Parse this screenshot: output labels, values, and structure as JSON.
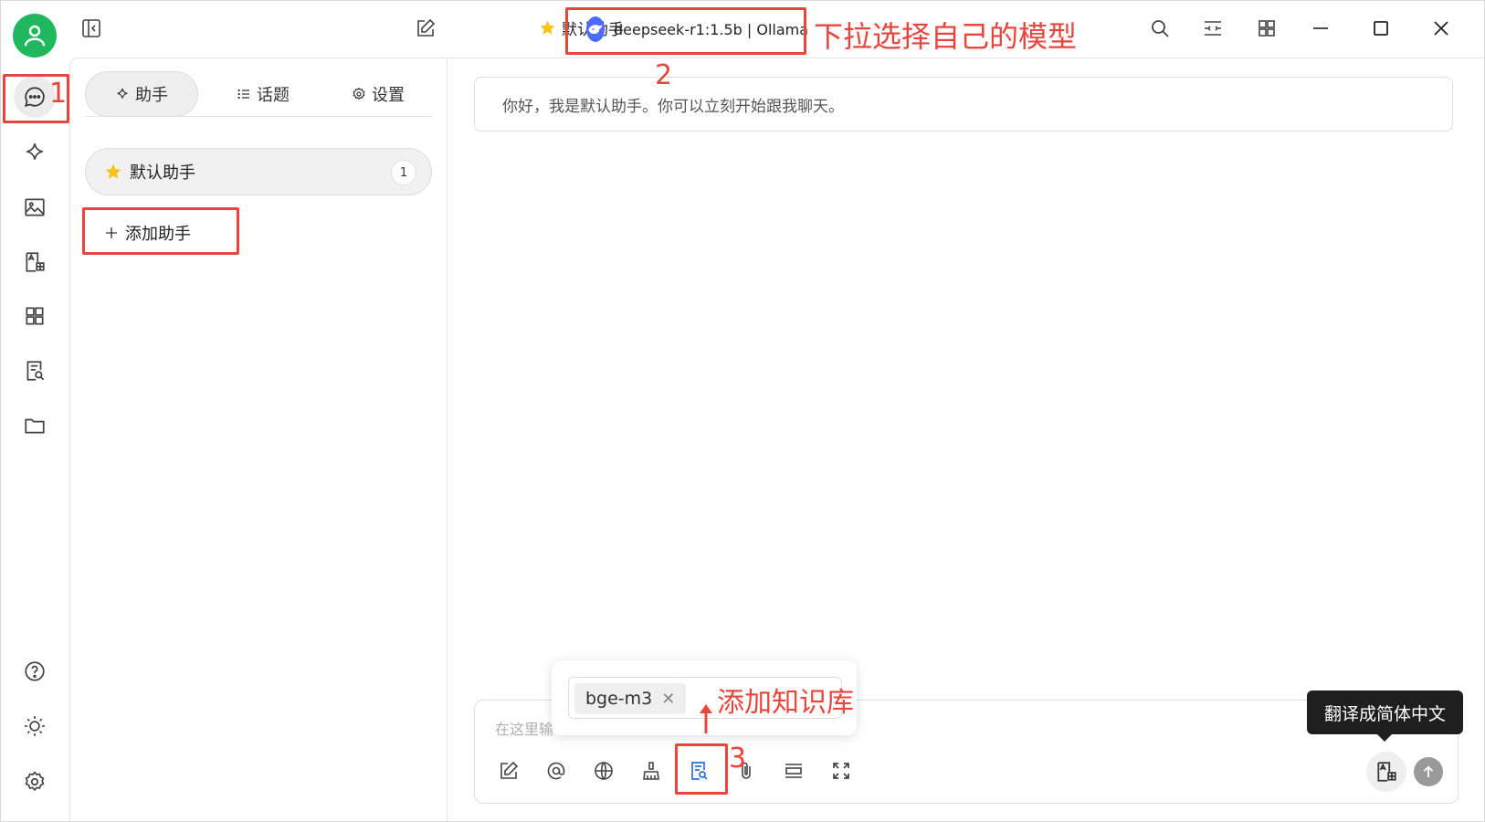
{
  "topbar": {
    "assistant_name": "默认助手",
    "model_name": "deepseek-r1:1.5b | Ollama"
  },
  "panel": {
    "tabs": [
      {
        "label": "助手"
      },
      {
        "label": "话题"
      },
      {
        "label": "设置"
      }
    ],
    "assistant_item": {
      "name": "默认助手",
      "count": "1"
    },
    "add_assistant_label": "添加助手"
  },
  "chat": {
    "welcome_message": "你好，我是默认助手。你可以立刻开始跟我聊天。",
    "input_placeholder": "在这里输",
    "knowledge_tag": "bge-m3",
    "translate_tooltip": "翻译成简体中文"
  },
  "annotations": {
    "step1": "1",
    "step2": "2",
    "step2_text": "下拉选择自己的模型",
    "step3": "3",
    "step3_text": "添加知识库"
  },
  "colors": {
    "annotation_red": "#e8453c",
    "avatar_green": "#1fb85f",
    "active_blue": "#2f6fde",
    "deepseek_blue": "#4d6bfe",
    "star_yellow": "#f6c21c"
  },
  "icons": {
    "rail": [
      "chat-icon",
      "sparkle-icon",
      "image-icon",
      "translate-icon",
      "apps-icon",
      "knowledge-icon",
      "folder-icon",
      "help-icon",
      "theme-icon",
      "settings-icon"
    ],
    "topbar": [
      "sidebar-toggle-icon",
      "new-chat-icon",
      "search-icon",
      "fit-width-icon",
      "apps-icon",
      "minimize-icon",
      "maximize-icon",
      "close-icon"
    ]
  }
}
